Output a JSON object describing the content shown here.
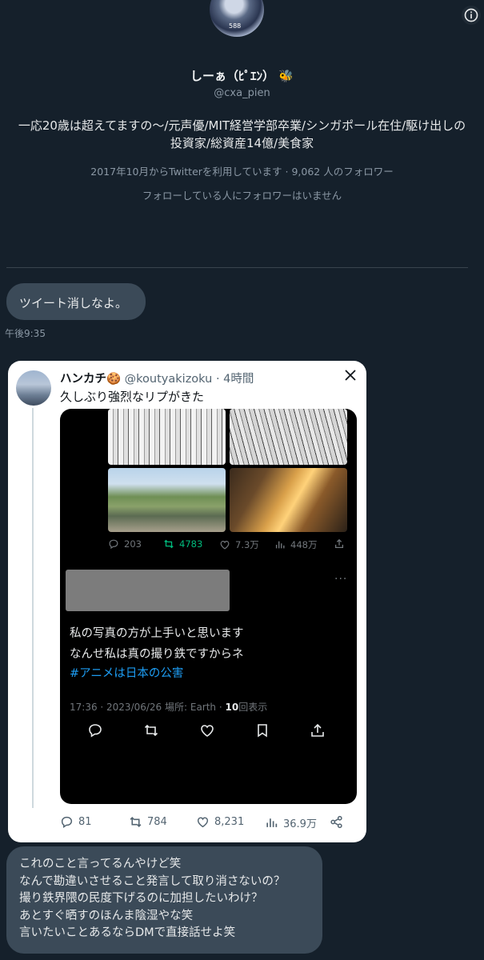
{
  "profile": {
    "avatar_text": "588",
    "name": "しーぁ（ﾋﾟｴﾝ）",
    "name_emoji": "🐝",
    "handle": "@cxa_pien",
    "bio": "一応20歳は超えてますの〜/元声優/MIT経営学部卒業/シンガポール在住/駆け出しの投資家/総資産14億/美食家",
    "joined_followers": "2017年10月からTwitterを利用しています · 9,062 人のフォロワー",
    "no_mutual": "フォローしている人にフォロワーはいません"
  },
  "messages": {
    "first_text": "ツイート消しなよ。",
    "first_time": "午後9:35",
    "last_lines": [
      "これのこと言ってるんやけど笑",
      "なんで勘違いさせること発言して取り消さないの？",
      "撮り鉄界隈の民度下げるのに加担したいわけ？",
      "あとすぐ晒すのほんま陰湿やな笑",
      "言いたいことあるならDMで直接話せよ笑"
    ]
  },
  "tweet": {
    "author_name": "ハンカチ🍪",
    "author_handle": "@koutyakizoku",
    "age": "· 4時間",
    "text": "久しぶり強烈なリプがきた",
    "quoted": {
      "stats": {
        "replies": "203",
        "retweets": "4783",
        "likes": "7.3万",
        "views": "448万"
      },
      "dots": "···",
      "line1": "私の写真の方が上手いと思います",
      "line2": "なんせ私は真の撮り鉄ですからネ",
      "hashtag": "#アニメは日本の公害",
      "meta_prefix": "17:36 · 2023/06/26 場所: Earth · ",
      "views_count": "10",
      "views_label": "回表示"
    },
    "stats": {
      "replies": "81",
      "retweets": "784",
      "likes": "8,231",
      "views": "36.9万"
    }
  },
  "colors": {
    "background": "#15202b",
    "bubble": "#3b4a58",
    "link": "#1d9bf0",
    "retweet_green": "#00ba7c"
  }
}
